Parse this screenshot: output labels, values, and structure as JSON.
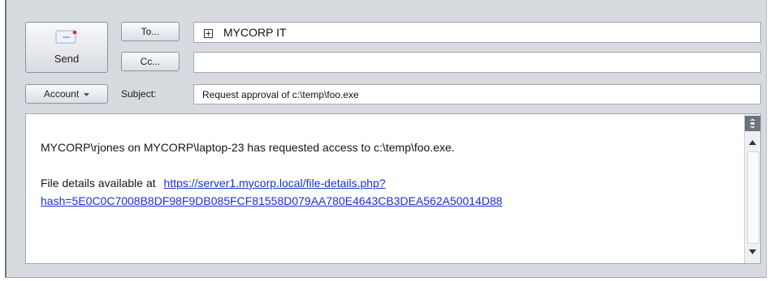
{
  "compose": {
    "send_label": "Send",
    "to_label": "To...",
    "cc_label": "Cc...",
    "account_label": "Account",
    "subject_label": "Subject:",
    "to_value": "MYCORP IT",
    "cc_value": "",
    "subject_value": "Request approval of c:\\temp\\foo.exe"
  },
  "message": {
    "line1": "MYCORP\\rjones on MYCORP\\laptop-23 has requested access to c:\\temp\\foo.exe.",
    "details_prefix": "File details available at",
    "link_part1": "https://server1.mycorp.local/file-details.php?",
    "link_part2": "hash=5E0C0C7008B8DF98F9DB085FCF81558D079AA780E4643CB3DEA562A50014D88"
  },
  "icons": {
    "expand": "plus-in-box",
    "account_dropdown": "triangle-down",
    "scroll_up": "triangle-up",
    "scroll_down": "triangle-down",
    "send": "envelope",
    "scrollbar_top": "collapse-arrows"
  }
}
